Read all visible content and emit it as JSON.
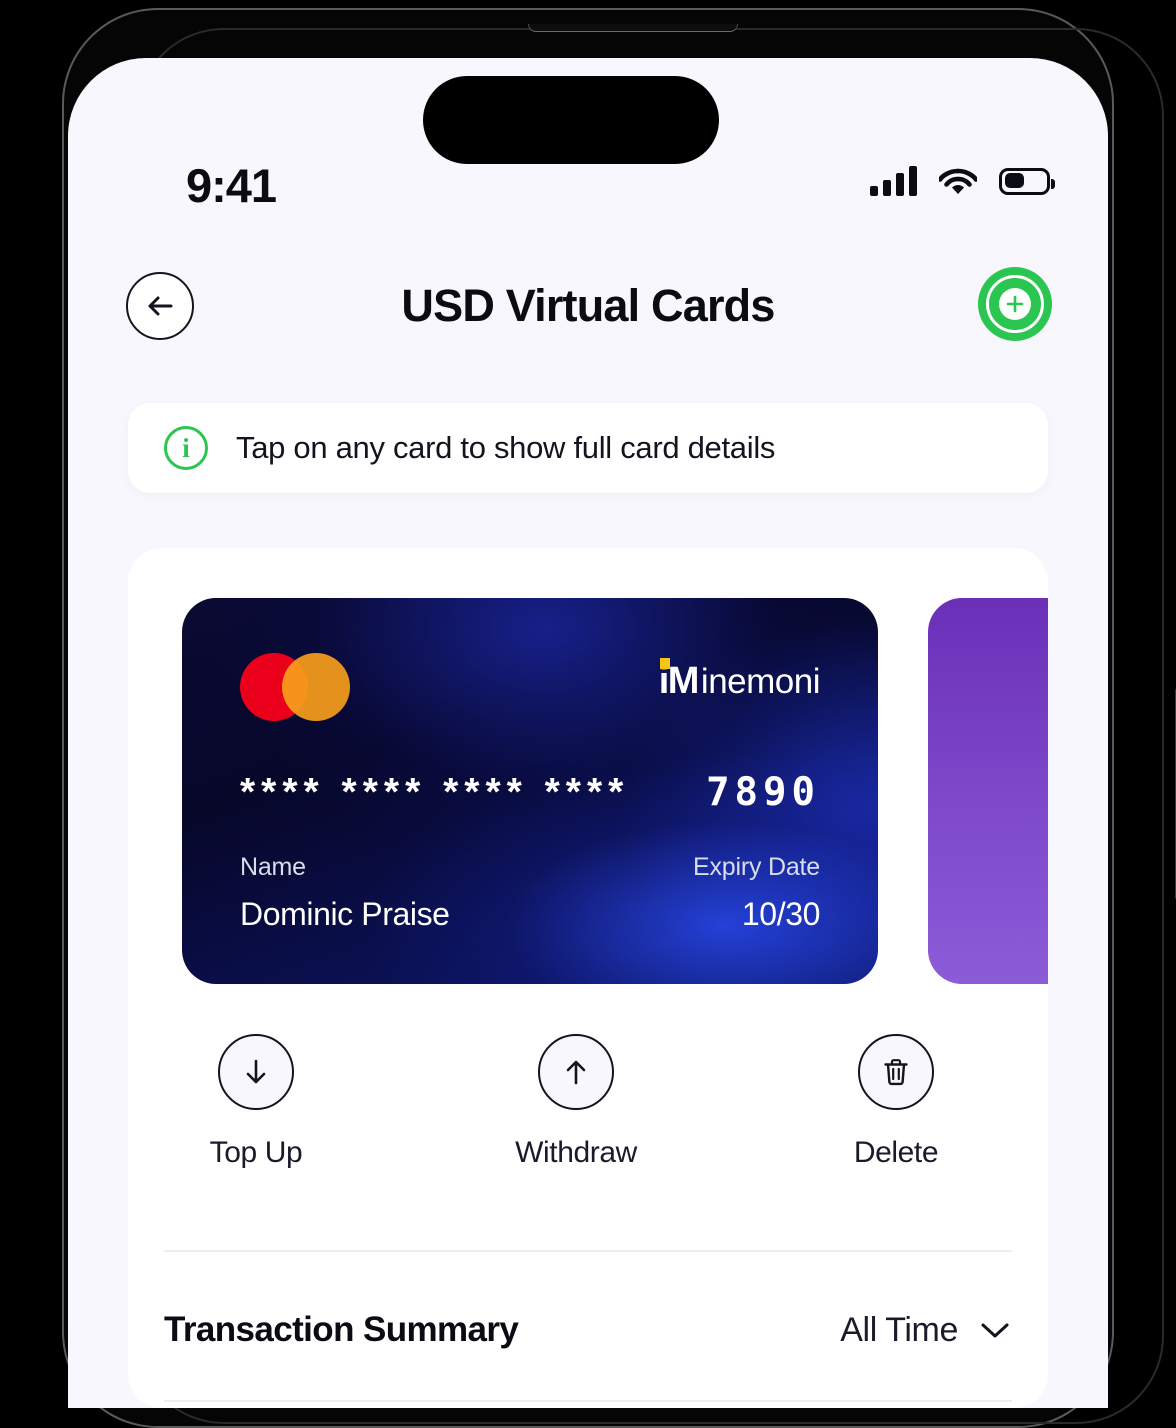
{
  "status_bar": {
    "time": "9:41",
    "signal_icon": "cellular-signal-icon",
    "wifi_icon": "wifi-icon",
    "battery_icon": "battery-icon",
    "battery_level_pct": 45
  },
  "header": {
    "back_icon": "arrow-left-icon",
    "title": "USD Virtual Cards",
    "add_icon": "plus-icon"
  },
  "info_banner": {
    "icon": "info-circle-icon",
    "text": "Tap on any card to show full card details"
  },
  "cards": [
    {
      "network": "mastercard",
      "brand_mark": "iM",
      "brand_rest": "inemoni",
      "number_masked": "****  ****  ****  ****",
      "number_last4": "7890",
      "name_label": "Name",
      "name_value": "Dominic Praise",
      "expiry_label": "Expiry Date",
      "expiry_value": "10/30",
      "accent_color": "#0d1a6e"
    },
    {
      "accent_color": "#7B45C8"
    }
  ],
  "actions": [
    {
      "icon": "arrow-down-icon",
      "label": "Top Up"
    },
    {
      "icon": "arrow-up-icon",
      "label": "Withdraw"
    },
    {
      "icon": "trash-icon",
      "label": "Delete"
    }
  ],
  "summary": {
    "title": "Transaction Summary",
    "filter_label": "All Time",
    "filter_icon": "chevron-down-icon"
  },
  "colors": {
    "brand_green": "#2BC552",
    "screen_bg": "#F7F7FD",
    "surface": "#FFFFFF",
    "text_primary": "#0B0B14",
    "mastercard_red": "#EB001B",
    "mastercard_orange": "#F79E1B",
    "logo_dot_yellow": "#F5C518"
  }
}
